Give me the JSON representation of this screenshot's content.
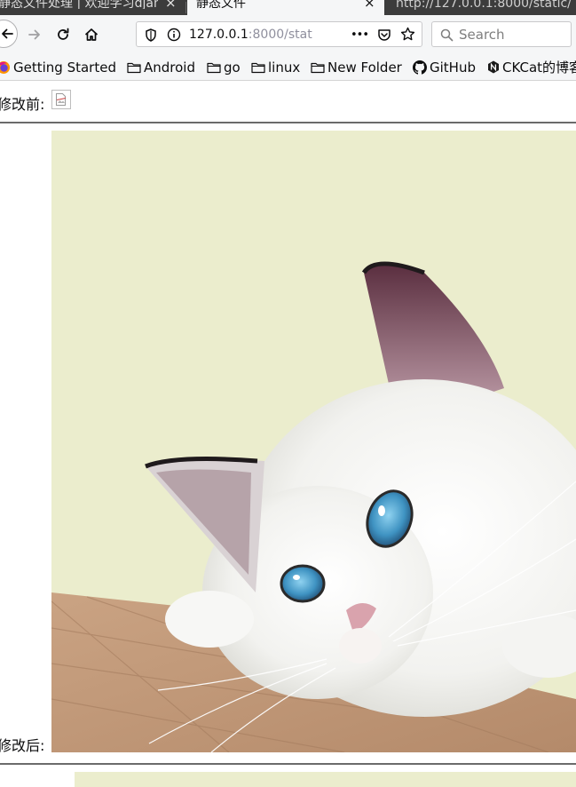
{
  "tabs": [
    {
      "title": "静态文件处理 | 欢迎学习django",
      "active": false
    },
    {
      "title": "静态文件",
      "active": true
    },
    {
      "title": "http://127.0.0.1:8000/static/",
      "active": false
    }
  ],
  "tab_close_glyph": "×",
  "nav": {
    "url_host": "127.0.0.1",
    "url_rest": ":8000/stat",
    "search_placeholder": "Search",
    "more_glyph": "•••"
  },
  "bookmarks": [
    {
      "label": "Getting Started",
      "icon": "firefox-icon"
    },
    {
      "label": "Android",
      "icon": "folder-icon"
    },
    {
      "label": "go",
      "icon": "folder-icon"
    },
    {
      "label": "linux",
      "icon": "folder-icon"
    },
    {
      "label": "New Folder",
      "icon": "folder-icon"
    },
    {
      "label": "GitHub",
      "icon": "github-icon"
    },
    {
      "label": "CKCat的博客",
      "icon": "site-icon"
    }
  ],
  "page": {
    "before_label": "修改前:",
    "after_label": "修改后:"
  },
  "colors": {
    "tabbar_bg": "#3c3c3c",
    "toolbar_bg": "#f5f6f7",
    "image_bg": "#ebedcd",
    "table_wood": "#c9a07e"
  }
}
